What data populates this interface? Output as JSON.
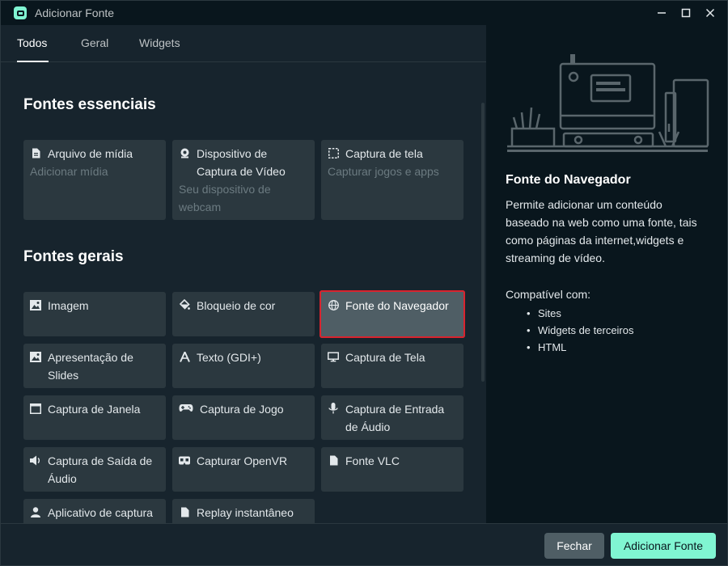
{
  "window": {
    "title": "Adicionar Fonte"
  },
  "tabs": [
    {
      "label": "Todos",
      "active": true
    },
    {
      "label": "Geral",
      "active": false
    },
    {
      "label": "Widgets",
      "active": false
    }
  ],
  "sections": {
    "essential": "Fontes essenciais",
    "general": "Fontes gerais"
  },
  "essential_sources": [
    {
      "name": "Arquivo de mídia",
      "desc": "Adicionar mídia",
      "icon": "file-icon"
    },
    {
      "name": "Dispositivo de Captura de Vídeo",
      "desc": "Seu dispositivo de webcam",
      "icon": "webcam-icon"
    },
    {
      "name": "Captura de tela",
      "desc": "Capturar jogos e apps",
      "icon": "screen-selection-icon"
    }
  ],
  "general_sources": [
    {
      "name": "Imagem",
      "icon": "image-icon"
    },
    {
      "name": "Bloqueio de cor",
      "icon": "paint-bucket-icon"
    },
    {
      "name": "Fonte do Navegador",
      "icon": "globe-icon",
      "selected": true
    },
    {
      "name": "Apresentação de Slides",
      "icon": "slideshow-icon"
    },
    {
      "name": "Texto (GDI+)",
      "icon": "text-icon"
    },
    {
      "name": "Captura de Tela",
      "icon": "monitor-icon"
    },
    {
      "name": "Captura de Janela",
      "icon": "window-icon"
    },
    {
      "name": "Captura de Jogo",
      "icon": "gamepad-icon"
    },
    {
      "name": "Captura de Entrada de Áudio",
      "icon": "microphone-icon"
    },
    {
      "name": "Captura de Saída de Áudio",
      "icon": "speaker-icon"
    },
    {
      "name": "Capturar OpenVR",
      "icon": "vr-headset-icon"
    },
    {
      "name": "Fonte VLC",
      "icon": "file-icon"
    },
    {
      "name": "Aplicativo de captura",
      "icon": "user-icon"
    },
    {
      "name": "Replay instantâneo",
      "icon": "file-icon"
    }
  ],
  "details": {
    "title": "Fonte do Navegador",
    "description": "Permite adicionar um conteúdo baseado na web como uma fonte, tais como páginas da internet,widgets e streaming de vídeo.",
    "compat_label": "Compatível com:",
    "compat_items": [
      "Sites",
      "Widgets de terceiros",
      "HTML"
    ]
  },
  "footer": {
    "close_label": "Fechar",
    "add_label": "Adicionar Fonte"
  },
  "colors": {
    "accent": "#80f5d2",
    "selection_outline": "#d9232e",
    "card": "#2b383f",
    "card_selected": "#4f5e65"
  }
}
